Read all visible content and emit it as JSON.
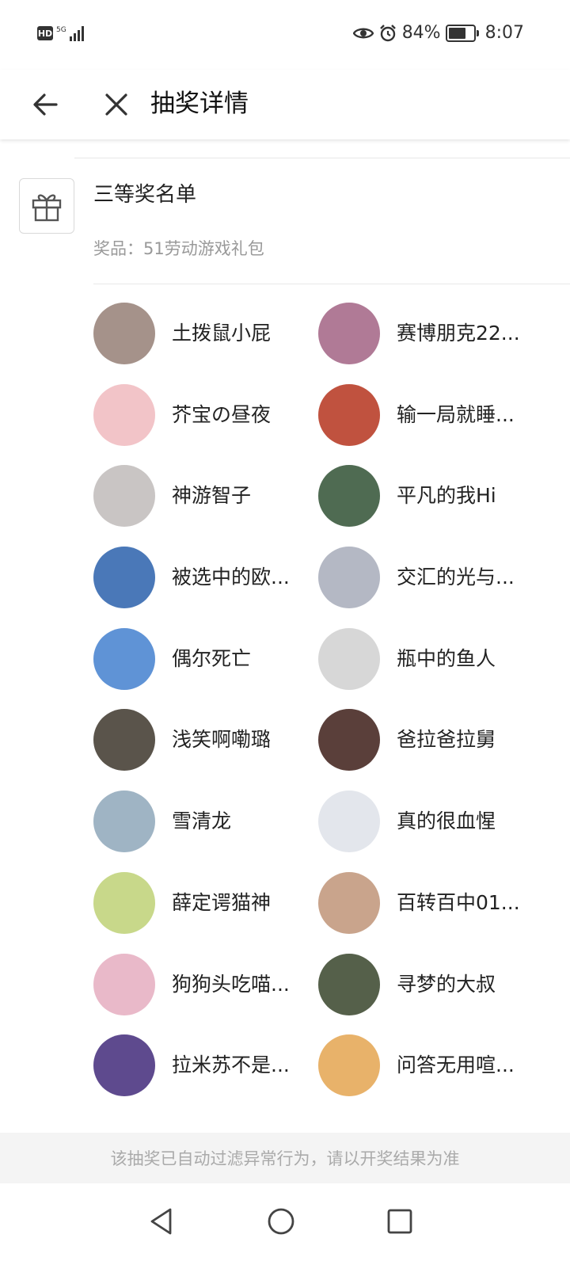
{
  "status_bar": {
    "hd_label": "HD",
    "network_label": "5G",
    "battery_percent": "84%",
    "battery_level": 0.84,
    "time": "8:07"
  },
  "header": {
    "title": "抽奖详情",
    "back_icon": "arrow-left-icon",
    "close_icon": "close-icon"
  },
  "section": {
    "title": "三等奖名单",
    "prize_text": "奖品：51劳动游戏礼包",
    "icon": "gift-icon"
  },
  "winners": [
    {
      "name": "土拨鼠小屁",
      "avatar_color": "#a5928a"
    },
    {
      "name": "赛博朋克22...",
      "avatar_color": "#b07a96"
    },
    {
      "name": "芥宝の昼夜",
      "avatar_color": "#f2c4c8"
    },
    {
      "name": "输一局就睡...",
      "avatar_color": "#c0523f"
    },
    {
      "name": "神游智子",
      "avatar_color": "#c9c5c4"
    },
    {
      "name": "平凡的我Hi",
      "avatar_color": "#4f6b52"
    },
    {
      "name": "被选中的欧...",
      "avatar_color": "#4a78b8"
    },
    {
      "name": "交汇的光与...",
      "avatar_color": "#b4b8c4"
    },
    {
      "name": "偶尔死亡",
      "avatar_color": "#5f93d6"
    },
    {
      "name": "瓶中的鱼人",
      "avatar_color": "#d7d7d7"
    },
    {
      "name": "浅笑啊嘞璐",
      "avatar_color": "#5a544b"
    },
    {
      "name": "爸拉爸拉舅",
      "avatar_color": "#5a3f3a"
    },
    {
      "name": "雪清龙",
      "avatar_color": "#9fb4c4"
    },
    {
      "name": "真的很血惺",
      "avatar_color": "#e3e6ec"
    },
    {
      "name": "薛定谔猫神",
      "avatar_color": "#c8d88a"
    },
    {
      "name": "百转百中01...",
      "avatar_color": "#c9a48c"
    },
    {
      "name": "狗狗头吃喵...",
      "avatar_color": "#e9b9c9"
    },
    {
      "name": "寻梦的大叔",
      "avatar_color": "#55604a"
    },
    {
      "name": "拉米苏不是...",
      "avatar_color": "#5e4a8e"
    },
    {
      "name": "问答无用喧...",
      "avatar_color": "#e8b26a"
    }
  ],
  "footer": {
    "notice": "该抽奖已自动过滤异常行为，请以开奖结果为准"
  },
  "nav_bar": {
    "back_icon": "triangle-back-icon",
    "home_icon": "circle-home-icon",
    "recents_icon": "square-recents-icon"
  }
}
